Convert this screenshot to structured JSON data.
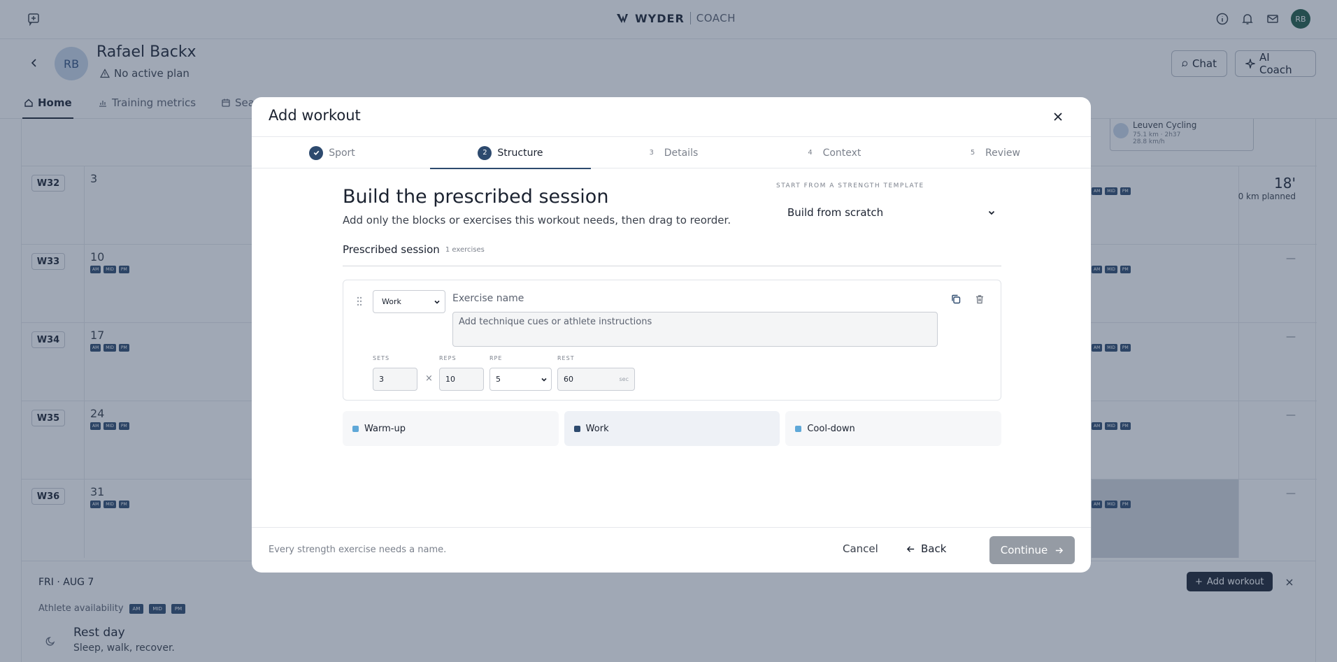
{
  "brand": {
    "name": "WYDER",
    "product": "COACH"
  },
  "user": {
    "initials": "RB"
  },
  "athlete": {
    "initials": "RB",
    "name": "Rafael Backx",
    "plan_status": "No active plan"
  },
  "header_buttons": {
    "chat": "Chat",
    "ai_coach": "AI Coach"
  },
  "tabs": [
    {
      "label": "Home",
      "icon": "home-icon"
    },
    {
      "label": "Training metrics",
      "icon": "chart-icon"
    },
    {
      "label": "Sea",
      "icon": "calendar-icon"
    }
  ],
  "calendar": {
    "slot_labels": [
      "AM",
      "MID",
      "PM"
    ],
    "ride_card": {
      "title": "Leuven Cycling",
      "meta": "75.1 km · 2h37",
      "speed": "28.8 km/h"
    },
    "weeks": [
      {
        "label": "W32",
        "day": "3",
        "total": "18'",
        "total_sub": "0 km planned"
      },
      {
        "label": "W33",
        "day": "10",
        "total": "—"
      },
      {
        "label": "W34",
        "day": "17",
        "total": "—"
      },
      {
        "label": "W35",
        "day": "24",
        "total": "—"
      },
      {
        "label": "W36",
        "day": "31",
        "total": "—"
      }
    ]
  },
  "day_detail": {
    "date": "FRI · AUG 7",
    "availability_label": "Athlete availability",
    "rest_title": "Rest day",
    "rest_sub": "Sleep, walk, recover.",
    "add_workout": "Add workout"
  },
  "modal": {
    "title": "Add workout",
    "steps": [
      {
        "num": "1",
        "label": "Sport",
        "state": "done"
      },
      {
        "num": "2",
        "label": "Structure",
        "state": "current"
      },
      {
        "num": "3",
        "label": "Details",
        "state": "upcoming"
      },
      {
        "num": "4",
        "label": "Context",
        "state": "upcoming"
      },
      {
        "num": "5",
        "label": "Review",
        "state": "upcoming"
      }
    ],
    "heading": "Build the prescribed session",
    "subheading": "Add only the blocks or exercises this workout needs, then drag to reorder.",
    "template_label": "START FROM A STRENGTH TEMPLATE",
    "template_value": "Build from scratch",
    "session_title": "Prescribed session",
    "session_count": "1 exercises",
    "exercise": {
      "phase": "Work",
      "name_placeholder": "Exercise name",
      "notes_placeholder": "Add technique cues or athlete instructions",
      "sets_label": "SETS",
      "sets": "3",
      "reps_label": "REPS",
      "reps": "10",
      "rpe_label": "RPE",
      "rpe": "5",
      "rest_label": "REST",
      "rest": "60",
      "rest_unit": "sec"
    },
    "add_blocks": [
      {
        "label": "Warm-up",
        "color": "#5fa8d8"
      },
      {
        "label": "Work",
        "color": "#2d4a6e"
      },
      {
        "label": "Cool-down",
        "color": "#5fa8d8"
      }
    ],
    "footer_hint": "Every strength exercise needs a name.",
    "cancel": "Cancel",
    "back": "Back",
    "continue": "Continue"
  }
}
